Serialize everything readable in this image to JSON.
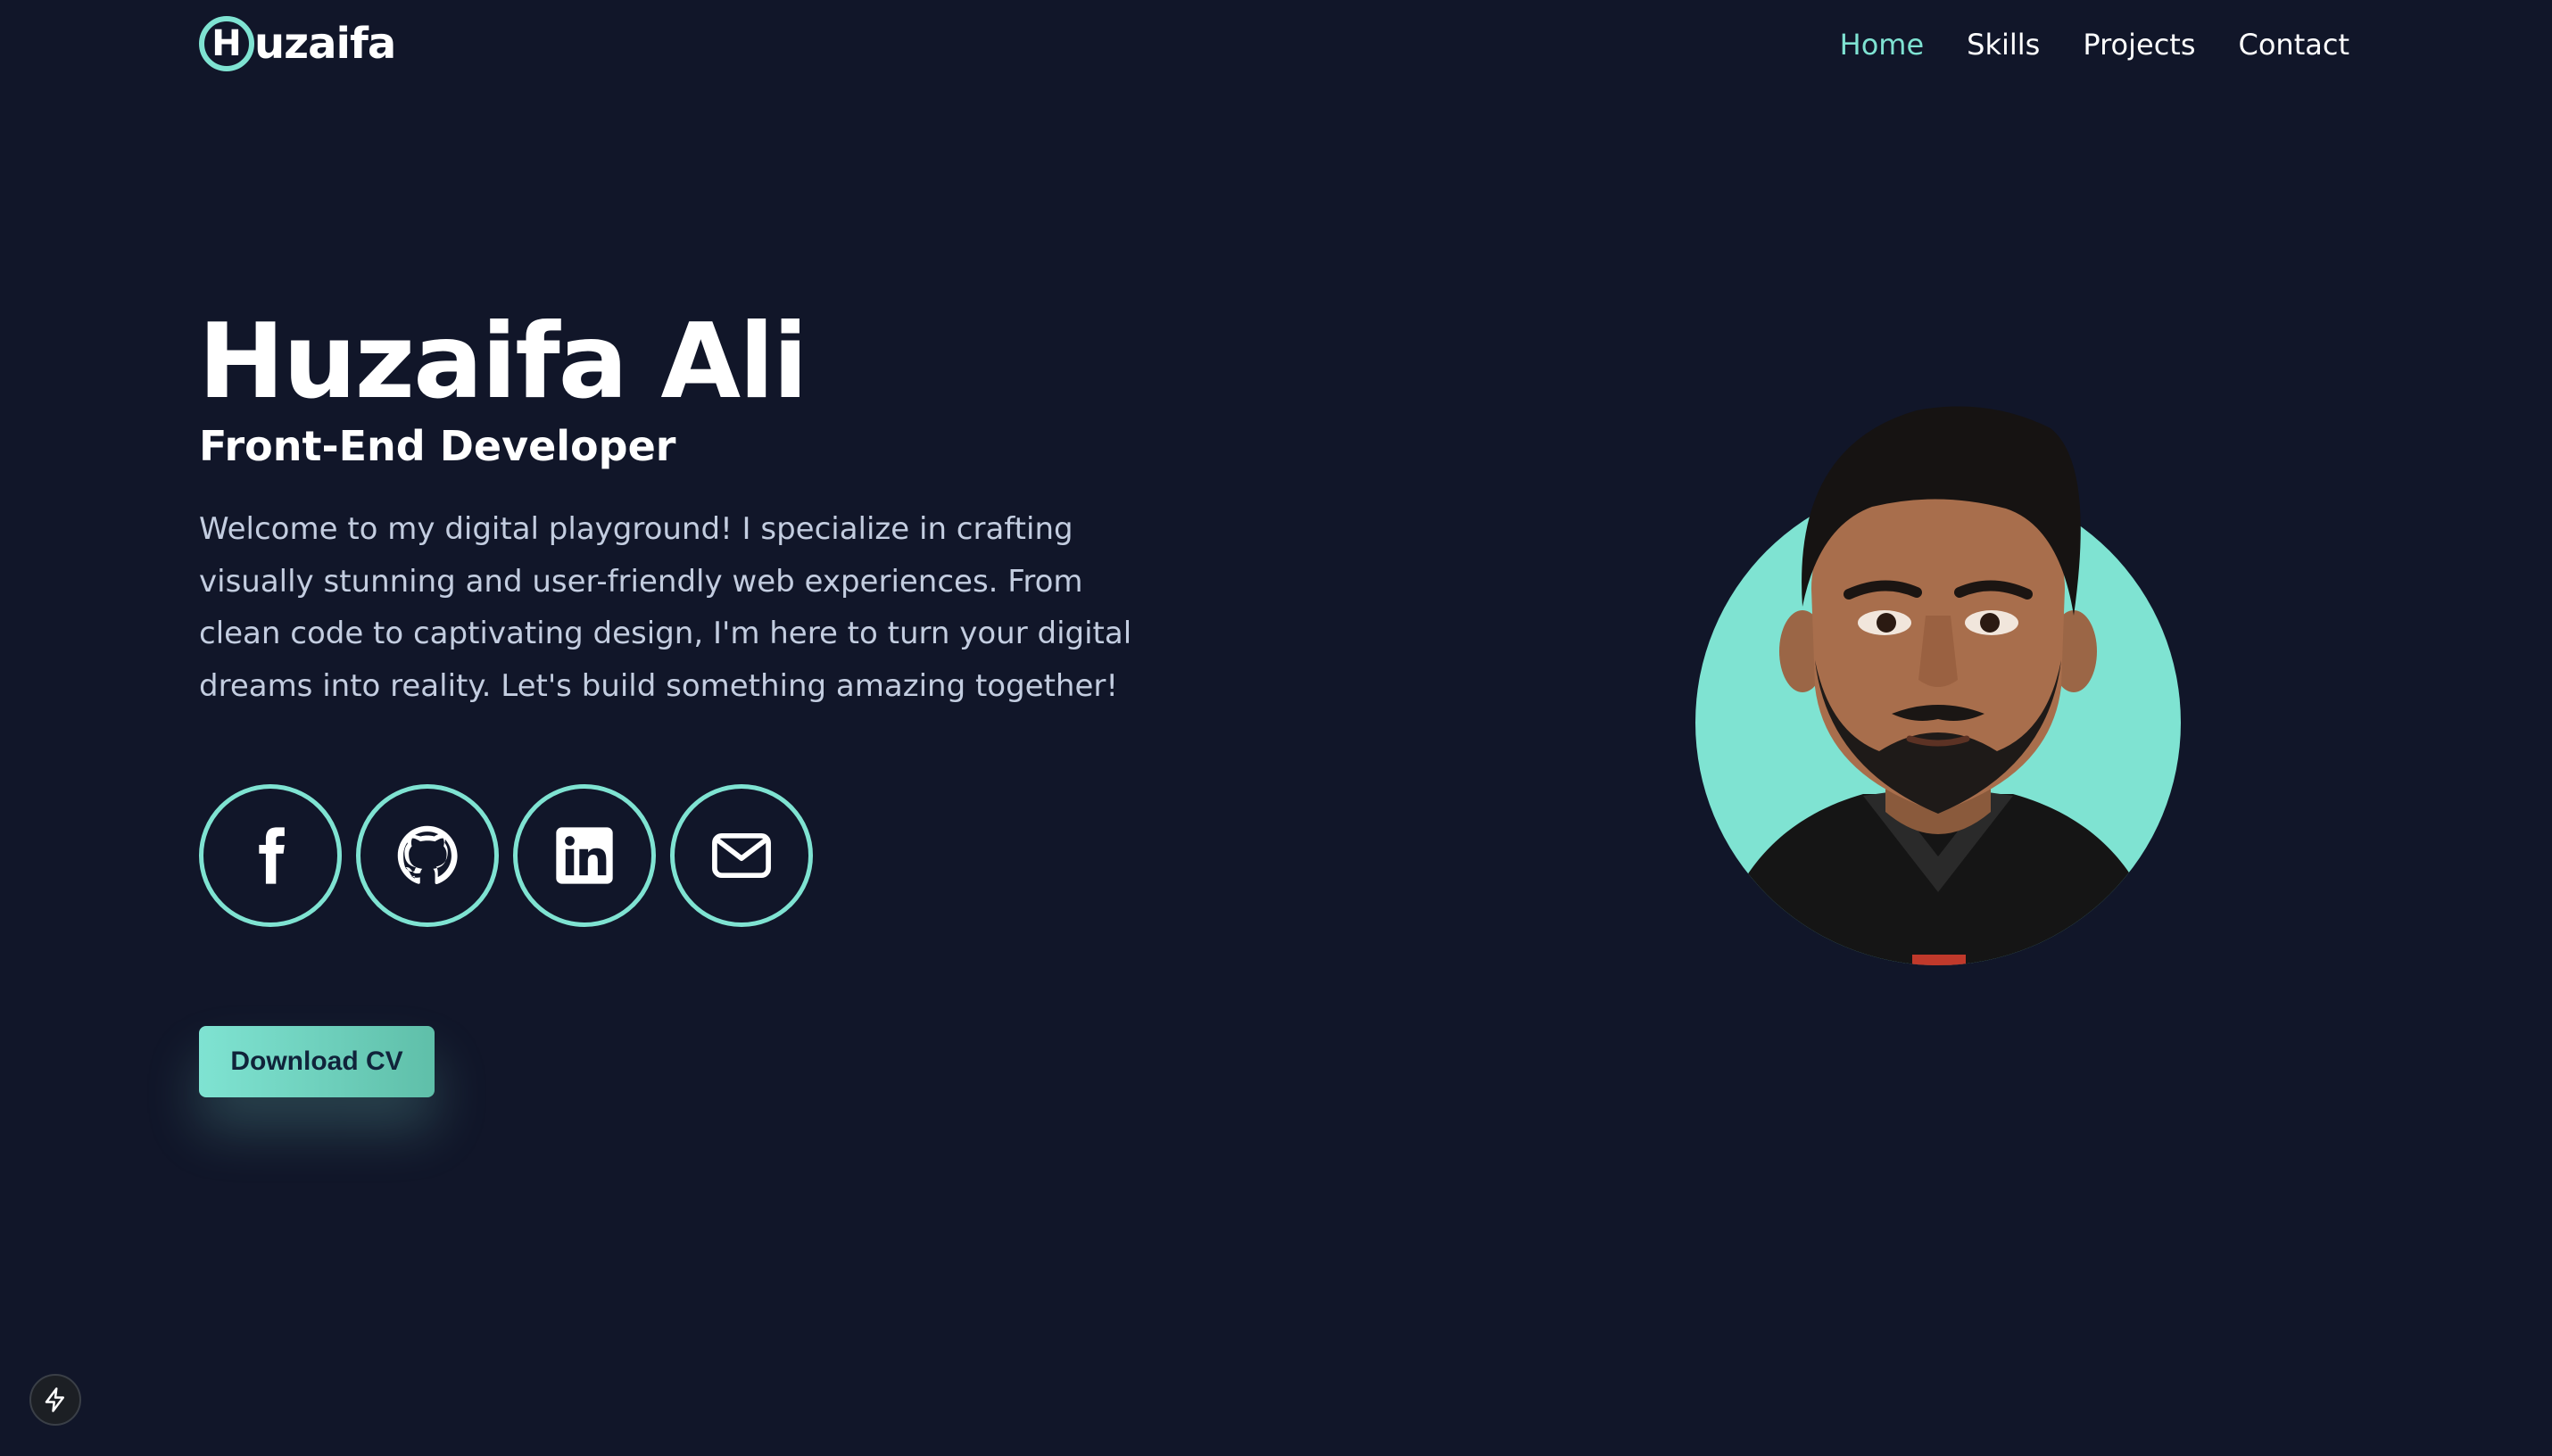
{
  "header": {
    "logo_letter": "H",
    "logo_text": "uzaifa",
    "nav": [
      {
        "label": "Home",
        "active": true
      },
      {
        "label": "Skills",
        "active": false
      },
      {
        "label": "Projects",
        "active": false
      },
      {
        "label": "Contact",
        "active": false
      }
    ]
  },
  "hero": {
    "name": "Huzaifa Ali",
    "role": "Front-End Developer",
    "description": "Welcome to my digital playground! I specialize in crafting visually stunning and user-friendly web experiences. From clean code to captivating design, I'm here to turn your digital dreams into reality. Let's build something amazing together!",
    "socials": [
      {
        "icon": "facebook-icon"
      },
      {
        "icon": "github-icon"
      },
      {
        "icon": "linkedin-icon"
      },
      {
        "icon": "mail-icon"
      }
    ],
    "cv_button": "Download CV"
  },
  "colors": {
    "background": "#111629",
    "accent": "#7fe3d2",
    "text_muted": "#c3cde0"
  }
}
